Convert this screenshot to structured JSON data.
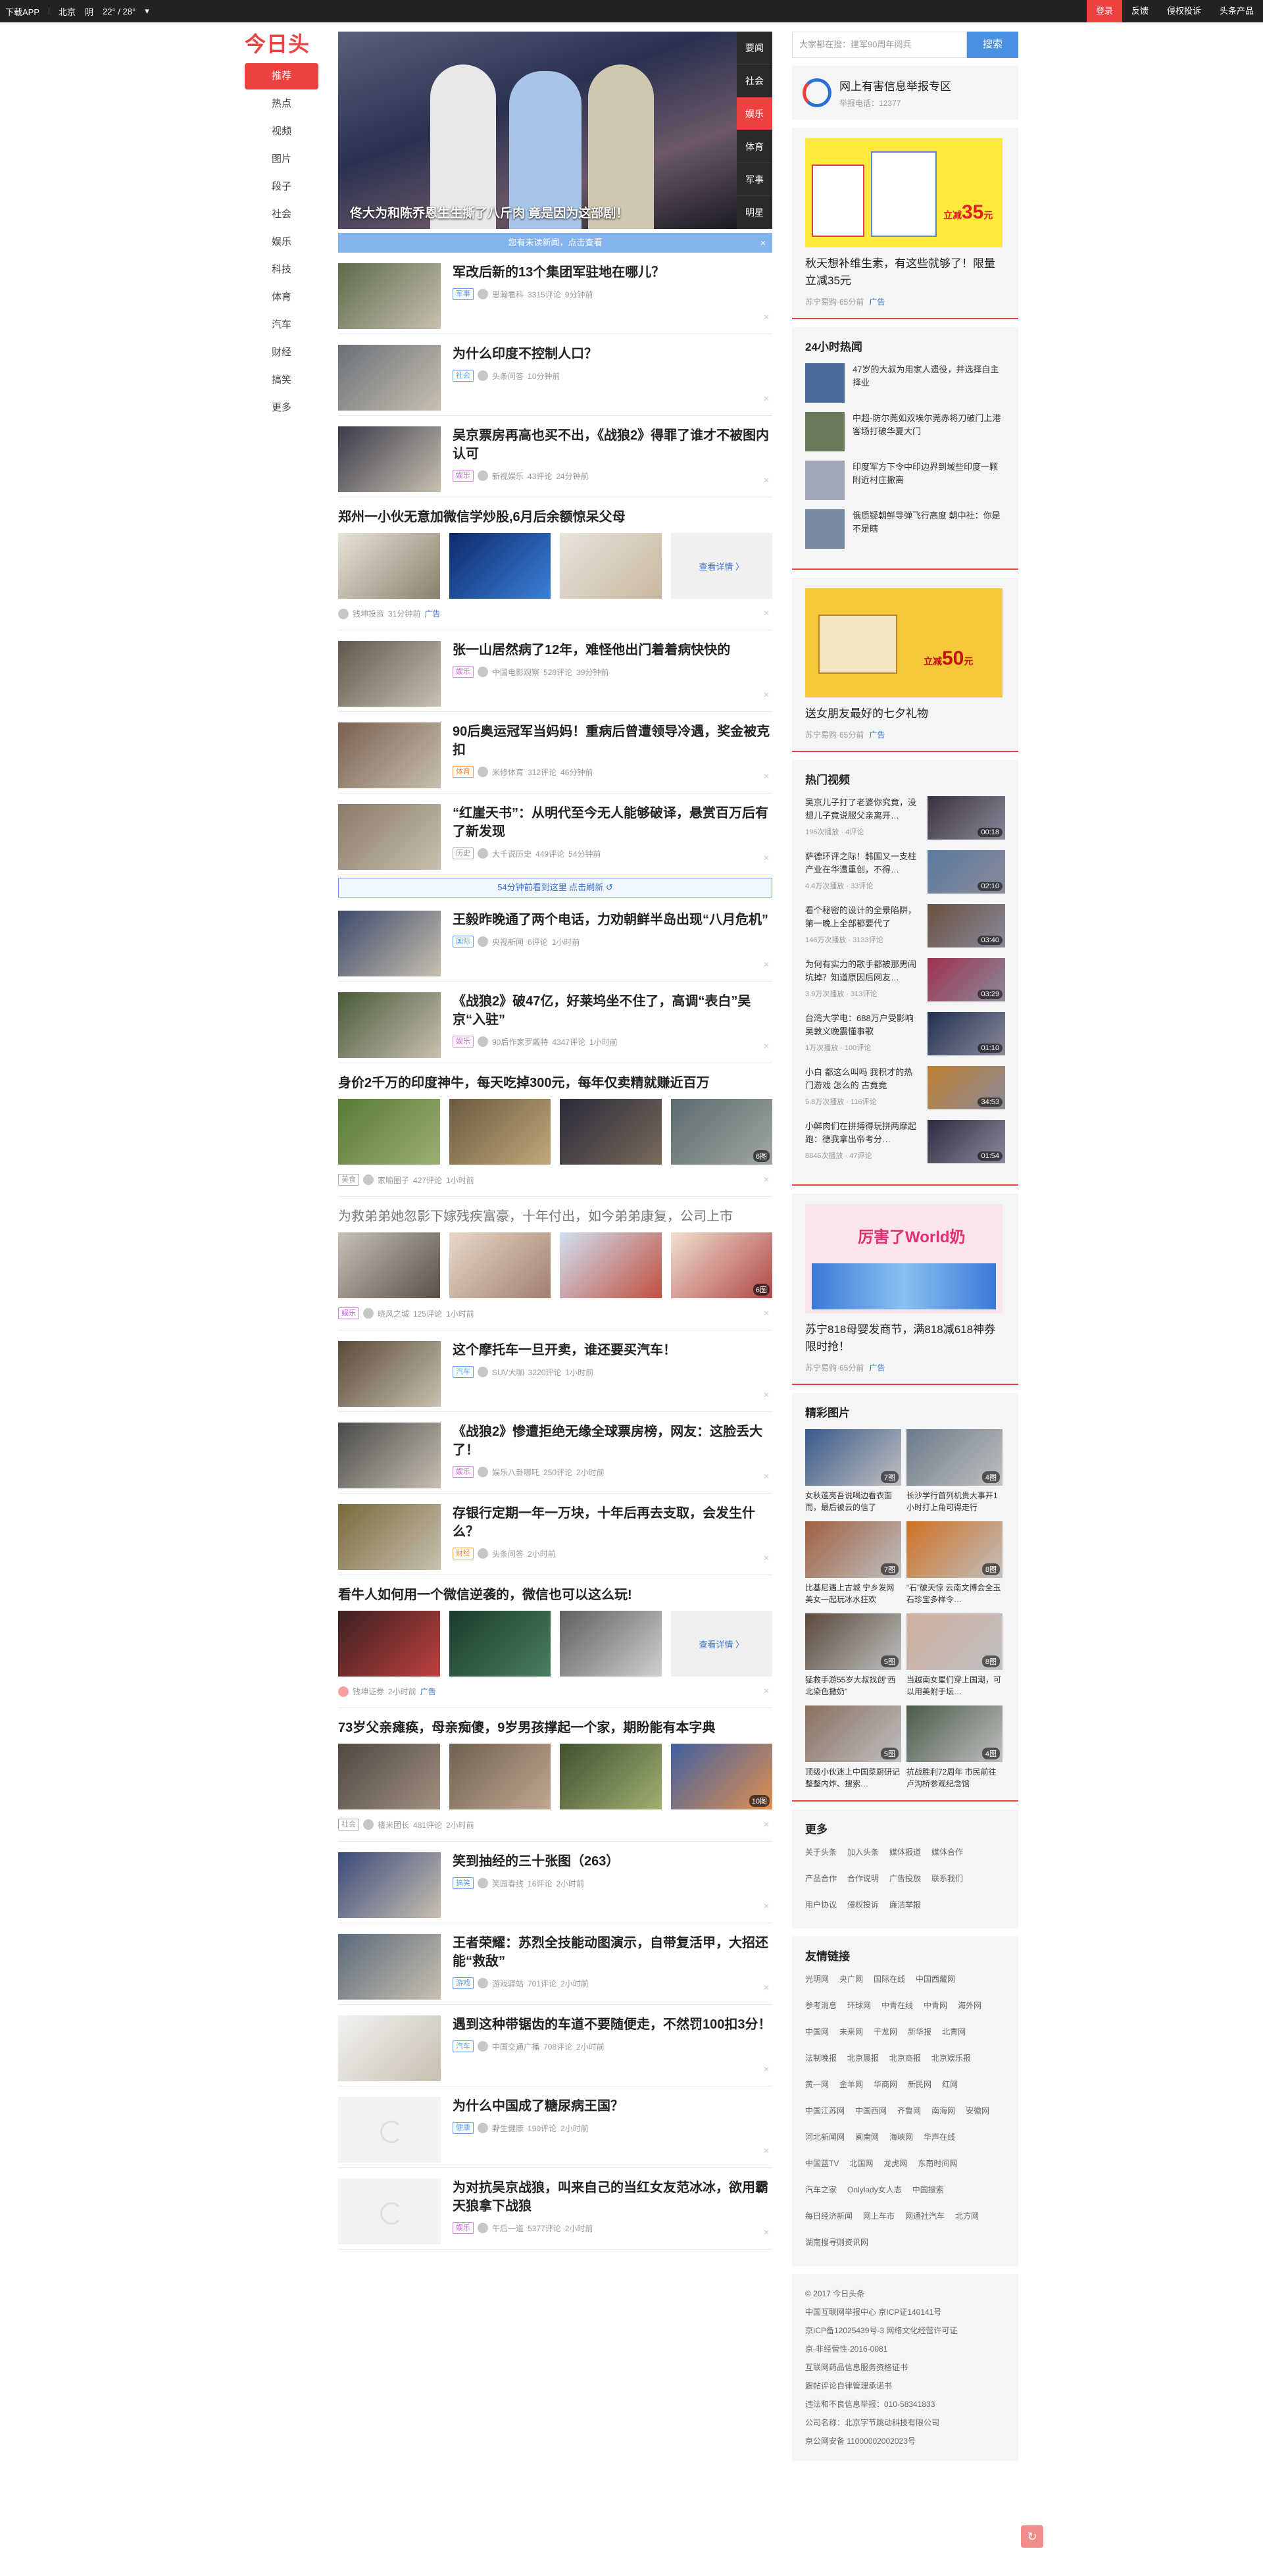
{
  "topbar": {
    "download": "下载APP",
    "city": "北京",
    "weather": "阴",
    "temp": "22° / 28°",
    "login": "登录",
    "feedback": "反馈",
    "complaint": "侵权投诉",
    "products": "头条产品"
  },
  "logo": "今日头条",
  "leftnav": [
    "推荐",
    "热点",
    "视频",
    "图片",
    "段子",
    "社会",
    "娱乐",
    "科技",
    "体育",
    "汽车",
    "财经",
    "搞笑",
    "更多"
  ],
  "hero": {
    "title": "佟大为和陈乔恩生生撕了八斤肉 竟是因为这部剧！",
    "tabs": [
      "要闻",
      "社会",
      "娱乐",
      "体育",
      "军事",
      "明星"
    ]
  },
  "notice": "您有未读新闻，点击查看",
  "refresh_text": "54分钟前看到这里  点击刷新 ↺",
  "articles_a": [
    {
      "title": "军改后新的13个集团军驻地在哪儿？",
      "tag": "军事",
      "tagc": "",
      "source": "思瀚看科",
      "comments": "3315评论",
      "time": "9分钟前"
    },
    {
      "title": "为什么印度不控制人口？",
      "tag": "社会",
      "tagc": "",
      "source": "头条问答",
      "comments": "",
      "time": "10分钟前"
    },
    {
      "title": "吴京票房再高也买不出，《战狼2》得罪了谁才不被图内认可",
      "tag": "娱乐",
      "tagc": "pink",
      "source": "新视娱乐",
      "comments": "43评论",
      "time": "24分钟前"
    }
  ],
  "ad1": {
    "title": "郑州一小伙无意加微信学炒股,6月后余额惊呆父母",
    "more": "查看详情 〉",
    "source": "钱坤投资",
    "time": "31分钟前",
    "ad": "广告"
  },
  "articles_b": [
    {
      "title": "张一山居然病了12年，难怪他出门着着病快快的",
      "tag": "娱乐",
      "tagc": "pink",
      "source": "中国电影观察",
      "comments": "528评论",
      "time": "39分钟前"
    },
    {
      "title": "90后奥运冠军当妈妈！重病后曾遭领导冷遇，奖金被克扣",
      "tag": "体育",
      "tagc": "orange",
      "source": "米修体育",
      "comments": "312评论",
      "time": "46分钟前"
    },
    {
      "title": "“红崖天书”：从明代至今无人能够破译，悬赏百万后有了新发现",
      "tag": "历史",
      "tagc": "gray",
      "source": "大千说历史",
      "comments": "449评论",
      "time": "54分钟前"
    }
  ],
  "articles_c": [
    {
      "title": "王毅昨晚通了两个电话，力劝朝鲜半岛出现“八月危机”",
      "tag": "国际",
      "tagc": "",
      "source": "央视新闻",
      "comments": "6评论",
      "time": "1小时前"
    },
    {
      "title": "《战狼2》破47亿，好莱坞坐不住了，高调“表白”吴京“入驻”",
      "tag": "娱乐",
      "tagc": "pink",
      "source": "90后作家罗戴特",
      "comments": "4347评论",
      "time": "1小时前"
    }
  ],
  "multi1": {
    "title": "身价2千万的印度神牛，每天吃掉300元，每年仅卖精就赚近百万",
    "tag": "美食",
    "source": "家喻圈子",
    "comments": "427评论",
    "time": "1小时前",
    "count": "6图"
  },
  "multi2": {
    "title": "为救弟弟她忽影下嫁残疾富豪，十年付出，如今弟弟康复，公司上市",
    "tag": "娱乐",
    "source": "晓风之城",
    "comments": "125评论",
    "time": "1小时前",
    "count": "6图"
  },
  "articles_d": [
    {
      "title": "这个摩托车一旦开卖，谁还要买汽车！",
      "tag": "汽车",
      "tagc": "",
      "source": "SUV大咖",
      "comments": "3220评论",
      "time": "1小时前"
    },
    {
      "title": "《战狼2》惨遭拒绝无缘全球票房榜，网友：这脸丢大了！",
      "tag": "娱乐",
      "tagc": "pink",
      "source": "娱乐八卦哪吒",
      "comments": "250评论",
      "time": "2小时前"
    },
    {
      "title": "存银行定期一年一万块，十年后再去支取，会发生什么？",
      "tag": "财经",
      "tagc": "orange",
      "source": "头条问答",
      "comments": "",
      "time": "2小时前"
    }
  ],
  "ad2": {
    "title": "看牛人如何用一个微信逆袭的，微信也可以这么玩!",
    "more": "查看详情 〉",
    "source": "钱坤证券",
    "time": "2小时前",
    "ad": "广告"
  },
  "multi3": {
    "title": "73岁父亲瘫痪，母亲痴傻，9岁男孩撑起一个家，期盼能有本字典",
    "tag": "社会",
    "source": "楼米团长",
    "comments": "481评论",
    "time": "2小时前",
    "count": "10图"
  },
  "articles_e": [
    {
      "title": "笑到抽经的三十张图（263）",
      "tag": "搞笑",
      "tagc": "",
      "source": "笑园春线",
      "comments": "16评论",
      "time": "2小时前"
    },
    {
      "title": "王者荣耀：苏烈全技能动图演示，自带复活甲，大招还能“救敌”",
      "tag": "游戏",
      "tagc": "",
      "source": "游戏驿站",
      "comments": "701评论",
      "time": "2小时前"
    },
    {
      "title": "遇到这种带锯齿的车道不要随便走，不然罚100扣3分！",
      "tag": "汽车",
      "tagc": "",
      "source": "中国交通广播",
      "comments": "708评论",
      "time": "2小时前"
    },
    {
      "title": "为什么中国成了糖尿病王国？",
      "tag": "健康",
      "tagc": "",
      "source": "野生健康",
      "comments": "190评论",
      "time": "2小时前"
    },
    {
      "title": "为对抗吴京战狼，叫来自己的当红女友范冰冰，欲用霸天狼拿下战狼",
      "tag": "娱乐",
      "tagc": "pink",
      "source": "午后一道",
      "comments": "5377评论",
      "time": "2小时前"
    }
  ],
  "search": {
    "placeholder": "大家都在搜：建军90周年阅兵",
    "button": "搜索"
  },
  "report": {
    "title": "网上有害信息举报专区",
    "phone": "举报电话：12377"
  },
  "ad_right1": {
    "title": "秋天想补维生素，有这些就够了！限量立减35元",
    "source": "苏宁易购·65分前",
    "ad": "广告",
    "price": "35",
    "label": "立减"
  },
  "hot": {
    "title": "24小时热闻",
    "items": [
      "47岁的大叔为用家人遗役，并选择自主择业",
      "中超-防尔莞如双埃尔莞赤将刀破门上港客场打破华夏大门",
      "印度军方下令中印边界到域些印度一颗附近村庄撤离",
      "俄质疑朝鲜导弹飞行高度 朝中社：你是不是瞎"
    ]
  },
  "ad_right2": {
    "title": "送女朋友最好的七夕礼物",
    "source": "苏宁易购·65分前",
    "ad": "广告",
    "price": "50",
    "label": "立减"
  },
  "videos": {
    "title": "热门视频",
    "items": [
      {
        "t": "吴京儿子打了老婆你究竟，没想儿子竟说服父亲离开…",
        "m": "196次播放 · 4评论",
        "d": "00:18"
      },
      {
        "t": "萨德环评之际！韩国又一支柱产业在华遭重创，不得…",
        "m": "4.4万次播放 · 33评论",
        "d": "02:10"
      },
      {
        "t": "看个秘密的设计的全景陷阱，第一晚上全部都要代了",
        "m": "146万次播放 · 3133评论",
        "d": "03:40"
      },
      {
        "t": "为何有实力的歌手都被那男闹坑掉？知道原因后网友…",
        "m": "3.9万次播放 · 313评论",
        "d": "03:29"
      },
      {
        "t": "台湾大学电：688万户受影响 吴敦义晚震懂事歌",
        "m": "1万次播放 · 100评论",
        "d": "01:10"
      },
      {
        "t": "小白 都这么叫吗 我积才的热门游戏 怎么的 古竟竟",
        "m": "5.8万次播放 · 116评论",
        "d": "34:53"
      },
      {
        "t": "小鲜肉们在拼搏得玩拼两摩起跑：德我拿出帝考分…",
        "m": "8846次播放 · 47评论",
        "d": "01:54"
      }
    ]
  },
  "ad_right3": {
    "title": "苏宁818母婴发商节，满818减618神券限时抢！",
    "source": "苏宁易购·65分前",
    "ad": "广告",
    "banner": "厉害了World奶"
  },
  "pics": {
    "title": "精彩图片",
    "items": [
      {
        "t": "女秋莲亮吾说喝边看衣面而，最后被云的信了",
        "c": "7图"
      },
      {
        "t": "长沙学行首列机贵大事开1小时打上角可得走行",
        "c": "4图"
      },
      {
        "t": "比基尼遇上古城 宁乡发网美女一起玩冰水狂欢",
        "c": "7图"
      },
      {
        "t": "“石”破天惊 云南文博会全玉石珍宝多样令…",
        "c": "8图"
      },
      {
        "t": "猛救手游55岁大叔找创“西北染色撒奶”",
        "c": "5图"
      },
      {
        "t": "当越南女星们穿上国潮，可以用美附于坛…",
        "c": "8图"
      },
      {
        "t": "顶级小伙迷上中国菜厨研记整整内炸、搜索…",
        "c": "5图"
      },
      {
        "t": "抗战胜利72周年 市民前往卢沟桥参观纪念馆",
        "c": "4图"
      }
    ]
  },
  "more": {
    "title": "更多",
    "items": [
      "关于头条",
      "加入头条",
      "媒体报道",
      "媒体合作",
      "产品合作",
      "合作说明",
      "广告投放",
      "联系我们",
      "用户协议",
      "侵权投诉",
      "廉洁举报"
    ]
  },
  "friends": {
    "title": "友情链接",
    "items": [
      "光明网",
      "央广网",
      "国际在线",
      "中国西藏网",
      "参考消息",
      "环球网",
      "中青在线",
      "中青网",
      "海外网",
      "中国网",
      "未来网",
      "千龙网",
      "新华报",
      "北青网",
      "法制晚报",
      "北京晨报",
      "北京商报",
      "北京娱乐报",
      "黄一网",
      "金羊网",
      "华商网",
      "新民网",
      "红网",
      "中国江苏网",
      "中国西网",
      "齐鲁网",
      "南海网",
      "安徽网",
      "河北新闻网",
      "闽南网",
      "海峡网",
      "华声在线",
      "中国蓝TV",
      "北国网",
      "龙虎网",
      "东南时间网",
      "汽车之家",
      "Onlylady女人志",
      "中国搜索",
      "每日经济新闻",
      "网上车市",
      "网通社汽车",
      "北方网",
      "湖南搜寻则资讯网"
    ]
  },
  "footer": {
    "lines": [
      "© 2017 今日头条",
      "中国互联网举报中心 京ICP证140141号",
      "京ICP备12025439号-3 网络文化经营许可证",
      "京-非经营性-2016-0081",
      "互联网药品信息服务资格证书",
      "跟帖评论自律管理承诺书",
      "违法和不良信息举报：010-58341833",
      "公司名称：北京字节跳动科技有限公司",
      "京公网安备 11000002002023号"
    ]
  },
  "scrolltop": "↻"
}
